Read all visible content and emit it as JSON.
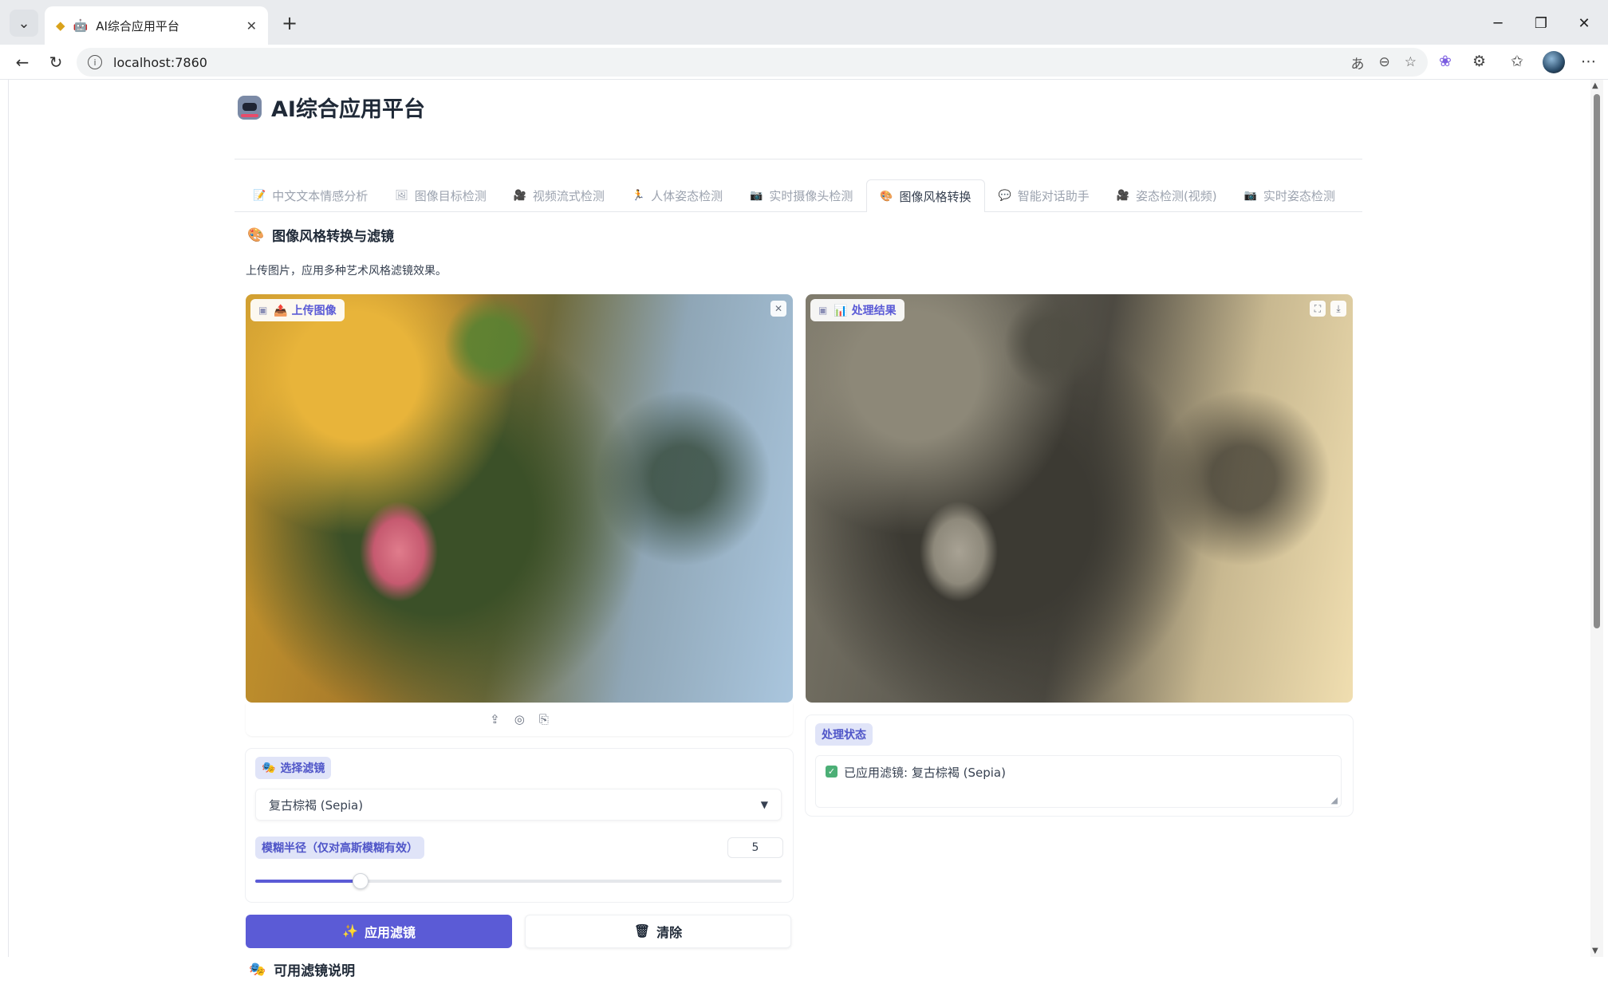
{
  "browser": {
    "tab_title": "AI综合应用平台",
    "url": "localhost:7860"
  },
  "app": {
    "title": "AI综合应用平台",
    "tabs": [
      {
        "icon": "📝",
        "label": "中文文本情感分析"
      },
      {
        "icon": "🖼",
        "label": "图像目标检测"
      },
      {
        "icon": "🎥",
        "label": "视频流式检测"
      },
      {
        "icon": "🏃",
        "label": "人体姿态检测"
      },
      {
        "icon": "📷",
        "label": "实时摄像头检测"
      },
      {
        "icon": "🎨",
        "label": "图像风格转换"
      },
      {
        "icon": "💬",
        "label": "智能对话助手"
      },
      {
        "icon": "🎥",
        "label": "姿态检测(视频)"
      },
      {
        "icon": "📷",
        "label": "实时姿态检测"
      }
    ],
    "active_tab": 5
  },
  "panel": {
    "title": "图像风格转换与滤镜",
    "description": "上传图片，应用多种艺术风格滤镜效果。",
    "upload_label": "📤 上传图像",
    "result_label": "📊 处理结果",
    "filter_label": "选择滤镜",
    "filter_value": "复古棕褐 (Sepia)",
    "blur_label": "模糊半径（仅对高斯模糊有效）",
    "blur_value": "5",
    "blur_min": 1,
    "blur_max": 21,
    "apply_button": "应用滤镜",
    "clear_button": "清除",
    "filters_help_heading": "可用滤镜说明",
    "status_label": "处理状态",
    "status_text": "已应用滤镜: 复古棕褐 (Sepia)"
  }
}
